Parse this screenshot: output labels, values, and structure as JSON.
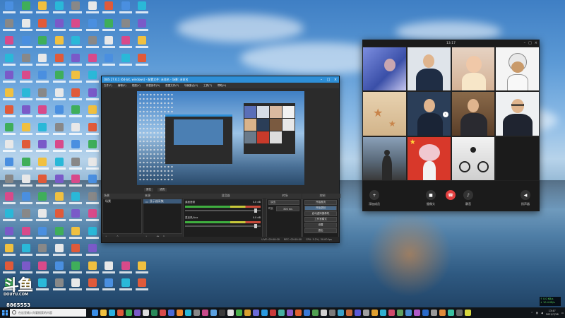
{
  "desktop": {
    "colors": {
      "sky_top": "#3f7fc4",
      "water": "#2f5a82"
    }
  },
  "watermark": {
    "logo_text": "斗鱼",
    "logo_sub": "DOUYU.COM",
    "room_id": "8865553"
  },
  "obs": {
    "title": "OBS 27.0.1 (64-bit, windows) - 配置文件: 未命名 - 场景: 未命名",
    "menu": [
      "文件(F)",
      "编辑(E)",
      "视图(V)",
      "停靠部件(D)",
      "配置文件(P)",
      "场景集合(S)",
      "工具(T)",
      "帮助(H)"
    ],
    "mid_bar": [
      "属性",
      "滤镜"
    ],
    "panels": {
      "scenes_header": "场景",
      "sources_header": "来源",
      "mixer_header": "混音器",
      "transitions_header": "转场",
      "controls_header": "控制"
    },
    "scenes": [
      "场景"
    ],
    "sources": [
      "显示器采集"
    ],
    "mixer": [
      {
        "name": "桌面音频",
        "level": "0.0 dB"
      },
      {
        "name": "麦克风/Aux",
        "level": "0.0 dB"
      }
    ],
    "transition": {
      "type": "淡出",
      "duration_label": "时长",
      "duration": "300 ms"
    },
    "controls": [
      "开始推流",
      "开始录制",
      "启动虚拟摄像机",
      "工作室模式",
      "设置",
      "退出"
    ],
    "status": [
      "LIVE: 00:00:00",
      "REC: 00:00:00",
      "CPU: 5.2%, 30.00 fps"
    ]
  },
  "meeting": {
    "title": "13:17",
    "buttons": [
      {
        "label": "添加成员",
        "icon": "add-person-icon"
      },
      {
        "label": "摄像头",
        "icon": "camera-icon"
      },
      {
        "label": "",
        "icon": "hangup-icon"
      },
      {
        "label": "静音",
        "icon": "mic-icon"
      },
      {
        "label": "扬声器",
        "icon": "speaker-icon"
      }
    ]
  },
  "taskbar": {
    "search_placeholder": "在这里输入你要搜索的内容",
    "time": "13:47",
    "date": "2021/7/28",
    "net_up": "↑ 0.0 KB/s",
    "net_down": "↓ 10.4 KB/s"
  }
}
